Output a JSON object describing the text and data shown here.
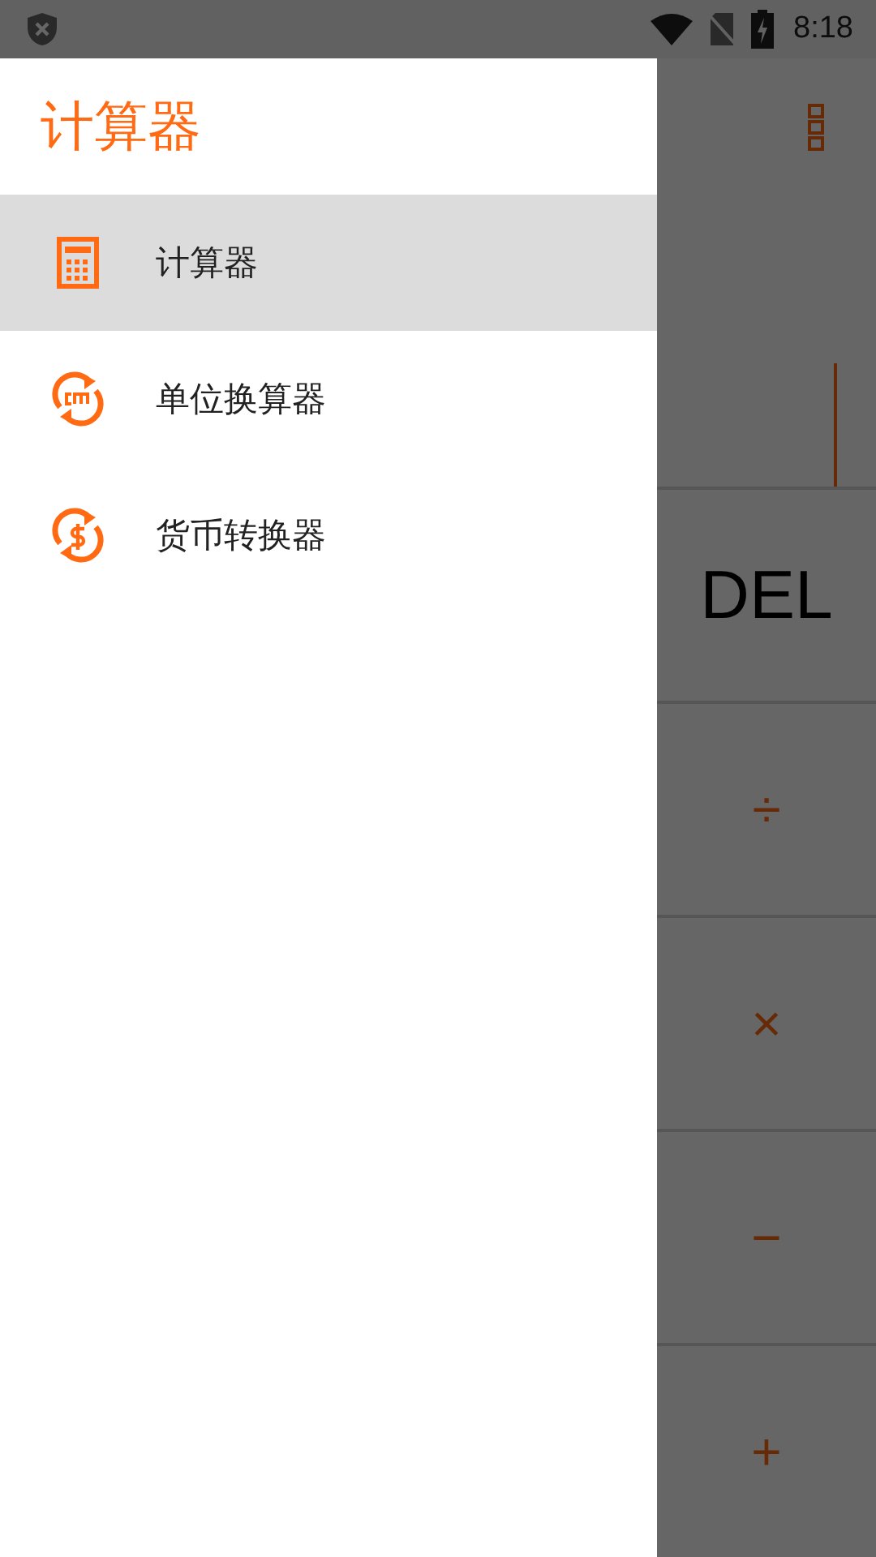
{
  "status_bar": {
    "time": "8:18"
  },
  "calculator": {
    "keys": [
      {
        "label": "DEL",
        "kind": "delete"
      },
      {
        "label": "÷",
        "kind": "operator"
      },
      {
        "label": "×",
        "kind": "operator"
      },
      {
        "label": "−",
        "kind": "operator"
      },
      {
        "label": "+",
        "kind": "operator"
      }
    ]
  },
  "drawer": {
    "title": "计算器",
    "items": [
      {
        "label": "计算器",
        "kind": "calculator",
        "selected": true
      },
      {
        "label": "单位换算器",
        "kind": "unit",
        "selected": false
      },
      {
        "label": "货币转换器",
        "kind": "currency",
        "selected": false
      }
    ]
  }
}
